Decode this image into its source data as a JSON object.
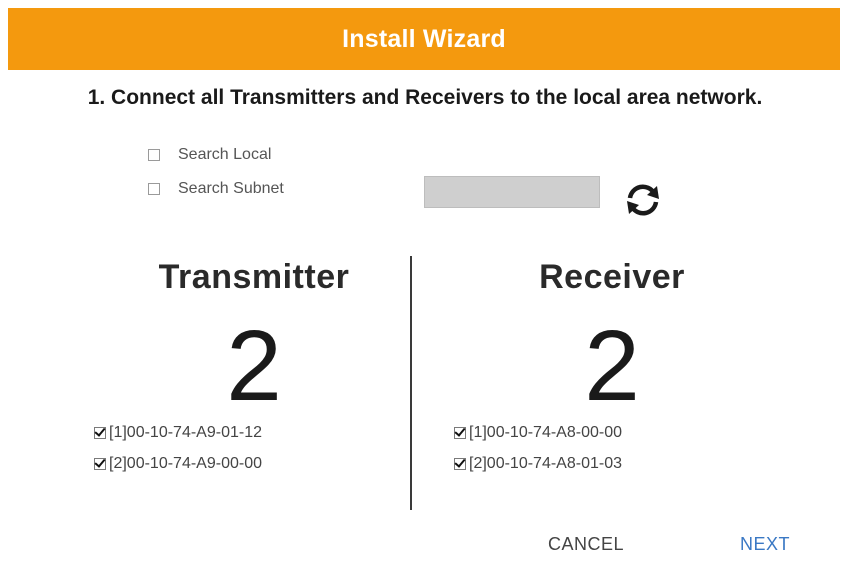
{
  "header": {
    "title": "Install Wizard",
    "background_color": "#f4990e"
  },
  "instruction": "1. Connect all Transmitters and Receivers to the local area network.",
  "search": {
    "local_label": "Search Local",
    "local_checked": false,
    "subnet_label": "Search Subnet",
    "subnet_checked": false,
    "subnet_value": "",
    "refresh_icon": "refresh-icon"
  },
  "transmitter": {
    "title": "Transmitter",
    "count": "2",
    "devices": [
      {
        "label": "[1]00-10-74-A9-01-12",
        "checked": true
      },
      {
        "label": "[2]00-10-74-A9-00-00",
        "checked": true
      }
    ]
  },
  "receiver": {
    "title": "Receiver",
    "count": "2",
    "devices": [
      {
        "label": "[1]00-10-74-A8-00-00",
        "checked": true
      },
      {
        "label": "[2]00-10-74-A8-01-03",
        "checked": true
      }
    ]
  },
  "footer": {
    "cancel_label": "CANCEL",
    "next_label": "NEXT",
    "next_color": "#3a78c4"
  }
}
